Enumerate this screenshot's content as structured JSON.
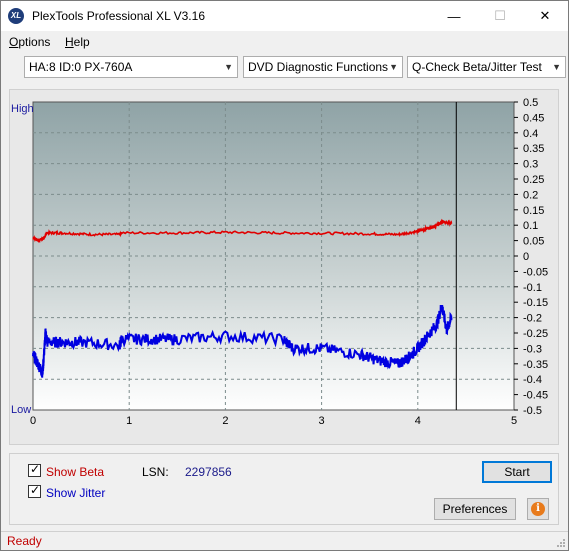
{
  "window": {
    "title": "PlexTools Professional XL V3.16",
    "app_icon_text": "XL",
    "min_glyph": "—",
    "max_glyph": "☐",
    "close_glyph": "✕"
  },
  "menu": {
    "items": [
      {
        "label": "Options"
      },
      {
        "label": "Help"
      }
    ]
  },
  "toolbar": {
    "drive": "HA:8 ID:0  PX-760A",
    "function": "DVD Diagnostic Functions",
    "test": "Q-Check Beta/Jitter Test",
    "arrow_glyph": "▼"
  },
  "chart_data": {
    "type": "line",
    "x_ticks": [
      "0",
      "1",
      "2",
      "3",
      "4",
      "5"
    ],
    "xlim": [
      0,
      5
    ],
    "y_left_labels": {
      "top": "High",
      "bottom": "Low"
    },
    "y_right_ticks": [
      "0.5",
      "0.45",
      "0.4",
      "0.35",
      "0.3",
      "0.25",
      "0.2",
      "0.15",
      "0.1",
      "0.05",
      "0",
      "-0.05",
      "-0.1",
      "-0.15",
      "-0.2",
      "-0.25",
      "-0.3",
      "-0.35",
      "-0.4",
      "-0.45",
      "-0.5"
    ],
    "ylim": [
      -0.5,
      0.5
    ],
    "grid": true,
    "end_marker_x": 4.4,
    "series": [
      {
        "name": "Beta",
        "color": "#e00000",
        "x": [
          0.0,
          0.05,
          0.12,
          0.14,
          0.3,
          0.6,
          0.9,
          0.92,
          1.5,
          2.0,
          2.5,
          3.0,
          3.5,
          3.8,
          4.0,
          4.1,
          4.2,
          4.25,
          4.3,
          4.35
        ],
        "y": [
          0.06,
          0.05,
          0.06,
          0.075,
          0.075,
          0.07,
          0.07,
          0.075,
          0.075,
          0.077,
          0.075,
          0.074,
          0.072,
          0.07,
          0.08,
          0.09,
          0.1,
          0.11,
          0.11,
          0.105
        ]
      },
      {
        "name": "Jitter",
        "color": "#0000e0",
        "x": [
          0.0,
          0.05,
          0.1,
          0.13,
          0.15,
          0.3,
          0.5,
          0.9,
          0.92,
          1.2,
          1.5,
          2.0,
          2.6,
          2.7,
          3.0,
          3.4,
          3.6,
          3.8,
          3.9,
          4.0,
          4.1,
          4.2,
          4.25,
          4.3,
          4.35
        ],
        "y": [
          -0.32,
          -0.35,
          -0.38,
          -0.25,
          -0.28,
          -0.28,
          -0.28,
          -0.29,
          -0.27,
          -0.27,
          -0.27,
          -0.26,
          -0.27,
          -0.3,
          -0.3,
          -0.32,
          -0.34,
          -0.35,
          -0.33,
          -0.3,
          -0.26,
          -0.22,
          -0.16,
          -0.24,
          -0.2
        ]
      }
    ]
  },
  "options": {
    "show_beta": "Show Beta",
    "show_jitter": "Show Jitter",
    "lsn_label": "LSN:",
    "lsn_value": "2297856",
    "start": "Start",
    "preferences": "Preferences",
    "info_glyph": "i"
  },
  "status": {
    "text": "Ready"
  }
}
